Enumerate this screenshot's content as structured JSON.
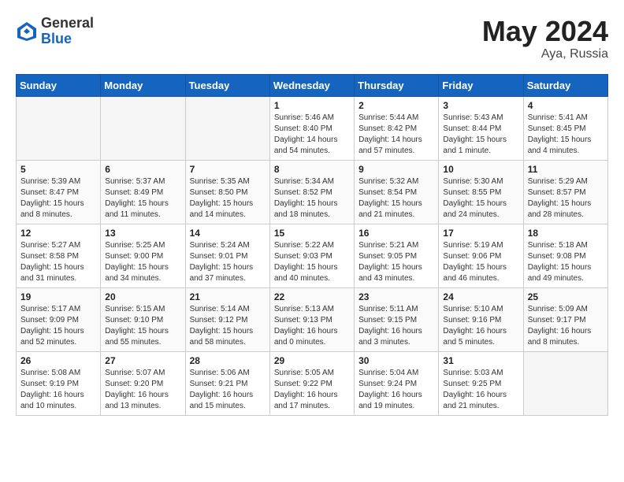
{
  "header": {
    "logo_general": "General",
    "logo_blue": "Blue",
    "month_year": "May 2024",
    "location": "Aya, Russia"
  },
  "weekdays": [
    "Sunday",
    "Monday",
    "Tuesday",
    "Wednesday",
    "Thursday",
    "Friday",
    "Saturday"
  ],
  "weeks": [
    [
      {
        "day": "",
        "detail": ""
      },
      {
        "day": "",
        "detail": ""
      },
      {
        "day": "",
        "detail": ""
      },
      {
        "day": "1",
        "detail": "Sunrise: 5:46 AM\nSunset: 8:40 PM\nDaylight: 14 hours\nand 54 minutes."
      },
      {
        "day": "2",
        "detail": "Sunrise: 5:44 AM\nSunset: 8:42 PM\nDaylight: 14 hours\nand 57 minutes."
      },
      {
        "day": "3",
        "detail": "Sunrise: 5:43 AM\nSunset: 8:44 PM\nDaylight: 15 hours\nand 1 minute."
      },
      {
        "day": "4",
        "detail": "Sunrise: 5:41 AM\nSunset: 8:45 PM\nDaylight: 15 hours\nand 4 minutes."
      }
    ],
    [
      {
        "day": "5",
        "detail": "Sunrise: 5:39 AM\nSunset: 8:47 PM\nDaylight: 15 hours\nand 8 minutes."
      },
      {
        "day": "6",
        "detail": "Sunrise: 5:37 AM\nSunset: 8:49 PM\nDaylight: 15 hours\nand 11 minutes."
      },
      {
        "day": "7",
        "detail": "Sunrise: 5:35 AM\nSunset: 8:50 PM\nDaylight: 15 hours\nand 14 minutes."
      },
      {
        "day": "8",
        "detail": "Sunrise: 5:34 AM\nSunset: 8:52 PM\nDaylight: 15 hours\nand 18 minutes."
      },
      {
        "day": "9",
        "detail": "Sunrise: 5:32 AM\nSunset: 8:54 PM\nDaylight: 15 hours\nand 21 minutes."
      },
      {
        "day": "10",
        "detail": "Sunrise: 5:30 AM\nSunset: 8:55 PM\nDaylight: 15 hours\nand 24 minutes."
      },
      {
        "day": "11",
        "detail": "Sunrise: 5:29 AM\nSunset: 8:57 PM\nDaylight: 15 hours\nand 28 minutes."
      }
    ],
    [
      {
        "day": "12",
        "detail": "Sunrise: 5:27 AM\nSunset: 8:58 PM\nDaylight: 15 hours\nand 31 minutes."
      },
      {
        "day": "13",
        "detail": "Sunrise: 5:25 AM\nSunset: 9:00 PM\nDaylight: 15 hours\nand 34 minutes."
      },
      {
        "day": "14",
        "detail": "Sunrise: 5:24 AM\nSunset: 9:01 PM\nDaylight: 15 hours\nand 37 minutes."
      },
      {
        "day": "15",
        "detail": "Sunrise: 5:22 AM\nSunset: 9:03 PM\nDaylight: 15 hours\nand 40 minutes."
      },
      {
        "day": "16",
        "detail": "Sunrise: 5:21 AM\nSunset: 9:05 PM\nDaylight: 15 hours\nand 43 minutes."
      },
      {
        "day": "17",
        "detail": "Sunrise: 5:19 AM\nSunset: 9:06 PM\nDaylight: 15 hours\nand 46 minutes."
      },
      {
        "day": "18",
        "detail": "Sunrise: 5:18 AM\nSunset: 9:08 PM\nDaylight: 15 hours\nand 49 minutes."
      }
    ],
    [
      {
        "day": "19",
        "detail": "Sunrise: 5:17 AM\nSunset: 9:09 PM\nDaylight: 15 hours\nand 52 minutes."
      },
      {
        "day": "20",
        "detail": "Sunrise: 5:15 AM\nSunset: 9:10 PM\nDaylight: 15 hours\nand 55 minutes."
      },
      {
        "day": "21",
        "detail": "Sunrise: 5:14 AM\nSunset: 9:12 PM\nDaylight: 15 hours\nand 58 minutes."
      },
      {
        "day": "22",
        "detail": "Sunrise: 5:13 AM\nSunset: 9:13 PM\nDaylight: 16 hours\nand 0 minutes."
      },
      {
        "day": "23",
        "detail": "Sunrise: 5:11 AM\nSunset: 9:15 PM\nDaylight: 16 hours\nand 3 minutes."
      },
      {
        "day": "24",
        "detail": "Sunrise: 5:10 AM\nSunset: 9:16 PM\nDaylight: 16 hours\nand 5 minutes."
      },
      {
        "day": "25",
        "detail": "Sunrise: 5:09 AM\nSunset: 9:17 PM\nDaylight: 16 hours\nand 8 minutes."
      }
    ],
    [
      {
        "day": "26",
        "detail": "Sunrise: 5:08 AM\nSunset: 9:19 PM\nDaylight: 16 hours\nand 10 minutes."
      },
      {
        "day": "27",
        "detail": "Sunrise: 5:07 AM\nSunset: 9:20 PM\nDaylight: 16 hours\nand 13 minutes."
      },
      {
        "day": "28",
        "detail": "Sunrise: 5:06 AM\nSunset: 9:21 PM\nDaylight: 16 hours\nand 15 minutes."
      },
      {
        "day": "29",
        "detail": "Sunrise: 5:05 AM\nSunset: 9:22 PM\nDaylight: 16 hours\nand 17 minutes."
      },
      {
        "day": "30",
        "detail": "Sunrise: 5:04 AM\nSunset: 9:24 PM\nDaylight: 16 hours\nand 19 minutes."
      },
      {
        "day": "31",
        "detail": "Sunrise: 5:03 AM\nSunset: 9:25 PM\nDaylight: 16 hours\nand 21 minutes."
      },
      {
        "day": "",
        "detail": ""
      }
    ]
  ]
}
